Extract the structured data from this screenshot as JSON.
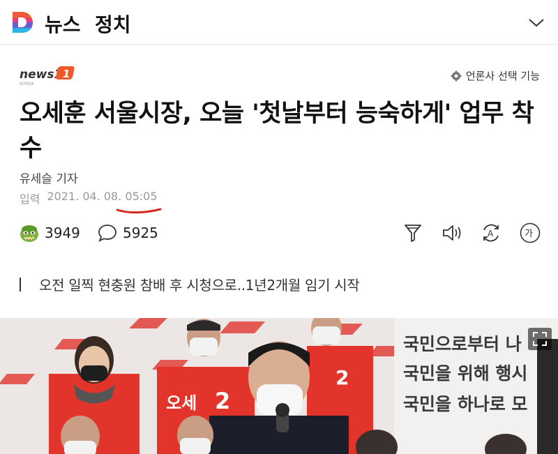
{
  "header": {
    "section": "뉴스",
    "category": "정치"
  },
  "press": {
    "logo_text": "news1",
    "logo_sub": "KOREA",
    "select_label": "언론사 선택 기능"
  },
  "article": {
    "title": "오세훈 서울시장, 오늘 '첫날부터 능숙하게' 업무 착수",
    "reporter": "유세슬 기자",
    "date_label": "입력",
    "date_value": "2021. 04. 08. 05:05",
    "summary": "오전 일찍 현충원 참배 후 시청으로..1년2개월 임기 시작"
  },
  "actions": {
    "reaction_count": "3949",
    "comment_count": "5925"
  },
  "photo": {
    "backdrop_lines": [
      "국민으로부터 나",
      "국민을 위해 행시",
      "국민을 하나로 모"
    ],
    "vest_texts": [
      "오세",
      "2"
    ]
  },
  "colors": {
    "accent_orange": "#f05a28",
    "underline_red": "#d9261c",
    "vest_red": "#e2342b"
  },
  "icons": {
    "logo": "daum-d-logo",
    "chevron": "chevron-down-icon",
    "settings": "gear-icon",
    "reaction": "reaction-emoji-icon",
    "comment": "speech-bubble-icon",
    "summary_tool": "funnel-icon",
    "listen": "speaker-icon",
    "translate": "translate-icon",
    "font": "font-size-icon",
    "expand": "expand-icon"
  }
}
